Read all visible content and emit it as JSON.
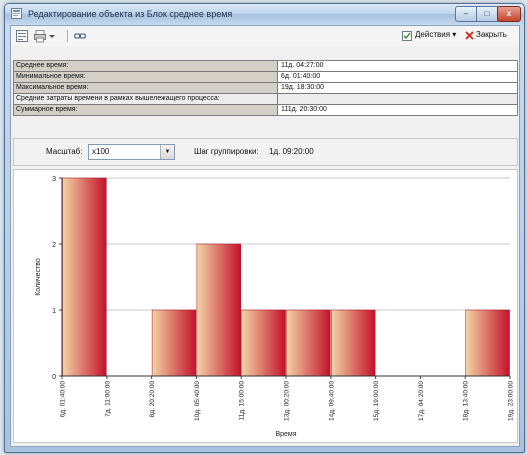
{
  "window": {
    "title": "Редактирование объекта  из Блок среднее время",
    "buttons": {
      "minimize": "–",
      "maximize": "□",
      "close": "x"
    }
  },
  "toolbar": {
    "actions_label": "Действия ▾",
    "close_label": "Закрыть"
  },
  "properties": [
    {
      "label": "Среднее время:",
      "value": "11д. 04:27:00"
    },
    {
      "label": "Минимальное время:",
      "value": "6д. 01:40:00"
    },
    {
      "label": "Максимальное время:",
      "value": "19д. 18:30:00"
    },
    {
      "label": "Средние затраты времени в рамках вышележащего процесса:",
      "value": ""
    },
    {
      "label": "Суммарное время:",
      "value": "111д. 20:30:00"
    }
  ],
  "controls": {
    "scale_label": "Масштаб:",
    "scale_value": "x100",
    "step_label": "Шаг группировки:",
    "step_value": "1д. 09:20:00"
  },
  "chart_data": {
    "type": "bar",
    "xlabel": "Время",
    "ylabel": "Количество",
    "ylim": [
      0,
      3
    ],
    "yticks": [
      "0",
      "1",
      "2",
      "3"
    ],
    "grid": true,
    "categories": [
      "6д. 01:40:00",
      "7д. 11:00:00",
      "8д. 20:20:00",
      "10д. 05:40:00",
      "11д. 15:00:00",
      "13д. 00:20:00",
      "14д. 09:40:00",
      "15д. 19:00:00",
      "17д. 04:20:00",
      "18д. 13:40:00",
      "19д. 23:00:00"
    ],
    "values": [
      3,
      0,
      1,
      2,
      1,
      1,
      1,
      0,
      0,
      1
    ],
    "colors": {
      "bar_dark": "#c4112a",
      "bar_light": "#f3d4a6"
    }
  }
}
